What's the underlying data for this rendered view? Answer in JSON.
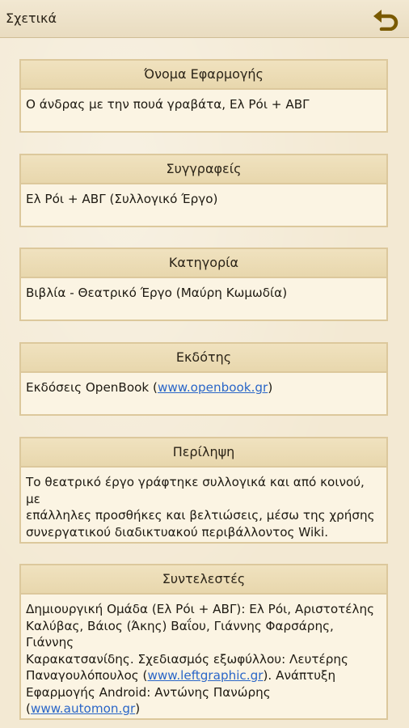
{
  "header": {
    "title": "Σχετικά"
  },
  "cards": [
    {
      "heading": "Όνομα Εφαρμογής",
      "text": "Ο άνδρας με την πουά γραβάτα, Ελ Ρόι + ΑΒΓ"
    },
    {
      "heading": "Συγγραφείς",
      "text": "Ελ Ρόι + ΑΒΓ (Συλλογικό Έργο)"
    },
    {
      "heading": "Κατηγορία",
      "text": "Βιβλία - Θεατρικό Έργο (Μαύρη Κωμωδία)"
    },
    {
      "heading": "Εκδότης",
      "text_before": "Εκδόσεις OpenBook (",
      "link": "www.openbook.gr",
      "text_after": ")"
    },
    {
      "heading": "Περίληψη",
      "line1": "Το θεατρικό έργο γράφτηκε συλλογικά και από κοινού, με",
      "line2": "επάλληλες προσθήκες και βελτιώσεις, μέσω της χρήσης",
      "line3": "συνεργατικού διαδικτυακού περιβάλλοντος Wiki."
    },
    {
      "heading": "Συντελεστές",
      "line1": "Δημιουργική Ομάδα (Ελ Ρόι + ΑΒΓ): Ελ Ρόι, Αριστοτέλης",
      "line2": "Καλύβας, Βάιος (Άκης) Βαΐου, Γιάννης Φαρσάρης, Γιάννης",
      "line3": "Καρακατσανίδης. Σχεδιασμός εξωφύλλου: Λευτέρης",
      "line4_before": "Παναγουλόπουλος (",
      "link1": "www.leftgraphic.gr",
      "line4_after": "). Ανάπτυξη",
      "line5": "Εφαρμογής Android: Αντώνης Πανώρης",
      "line6_before": "(",
      "link2": "www.automon.gr",
      "line6_after": ")"
    }
  ],
  "colors": {
    "background": "#f3e9d3",
    "card_border": "#dcc89c",
    "link": "#2a66c8",
    "back_icon": "#7a5a00"
  },
  "icons": {
    "back": "back-arrow-icon"
  }
}
